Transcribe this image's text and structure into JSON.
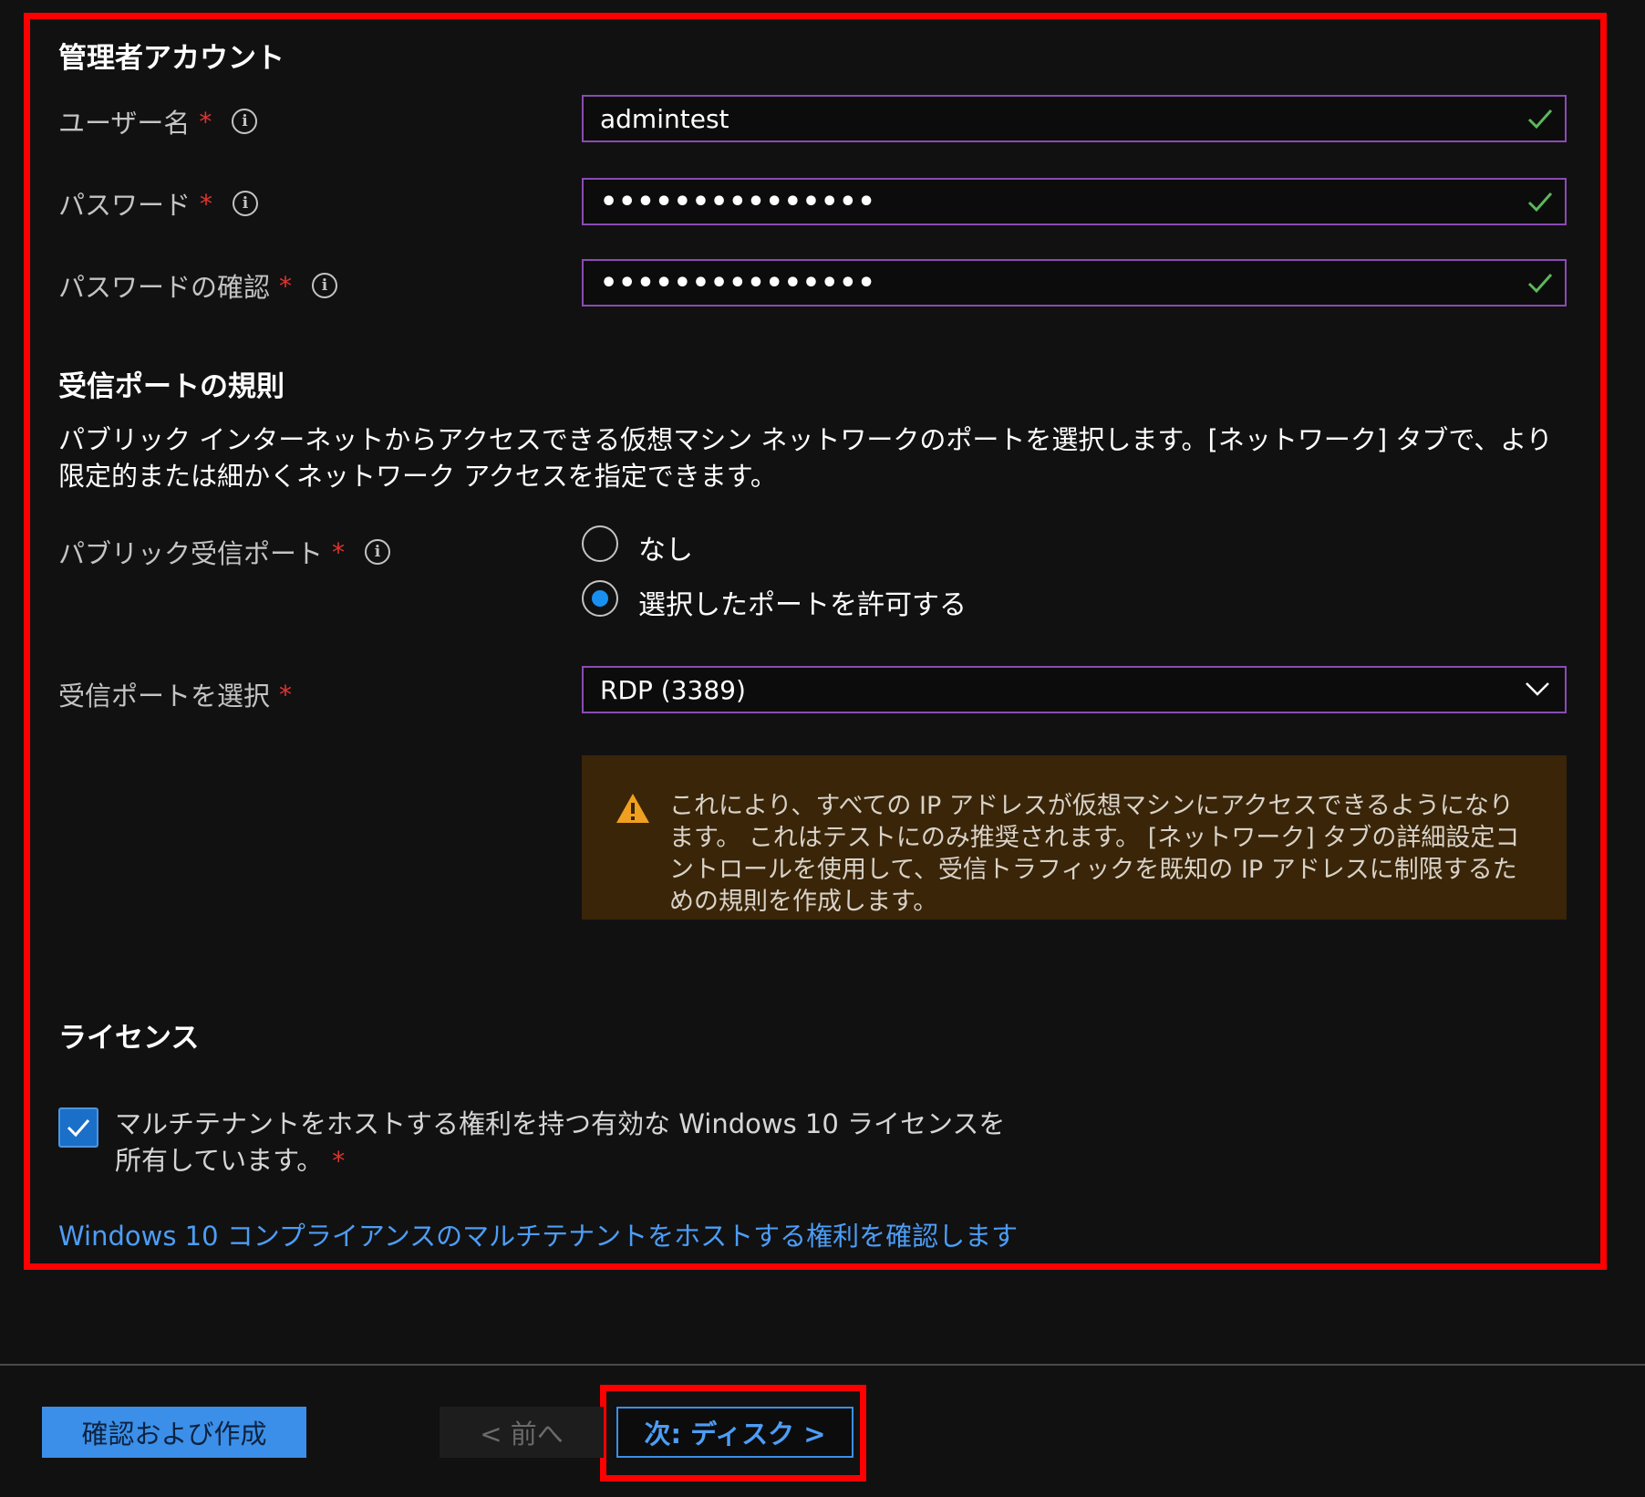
{
  "admin": {
    "section_title": "管理者アカウント",
    "username_label": "ユーザー名",
    "username_value": "admintest",
    "password_label": "パスワード",
    "password_value": "•••••••••••••••",
    "confirm_label": "パスワードの確認",
    "confirm_value": "•••••••••••••••",
    "required_mark": "*",
    "info_glyph": "i"
  },
  "inbound": {
    "section_title": "受信ポートの規則",
    "description": "パブリック インターネットからアクセスできる仮想マシン ネットワークのポートを選択します。[ネットワーク] タブで、より限定的または細かくネットワーク アクセスを指定できます。",
    "public_port_label": "パブリック受信ポート",
    "option_none": "なし",
    "option_allow": "選択したポートを許可する",
    "selected_option": "選択したポートを許可する",
    "select_ports_label": "受信ポートを選択",
    "select_ports_value": "RDP (3389)",
    "warning": "これにより、すべての IP アドレスが仮想マシンにアクセスできるようになります。 これはテストにのみ推奨されます。 [ネットワーク] タブの詳細設定コントロールを使用して、受信トラフィックを既知の IP アドレスに制限するための規則を作成します。"
  },
  "license": {
    "section_title": "ライセンス",
    "checkbox_label": "マルチテナントをホストする権利を持つ有効な Windows 10 ライセンスを所有しています。",
    "checked": true,
    "link": "Windows 10 コンプライアンスのマルチテナントをホストする権利を確認します"
  },
  "footer": {
    "review_create": "確認および作成",
    "prev": "< 前へ",
    "next": "次: ディスク >"
  },
  "colors": {
    "highlight": "#ff0000",
    "accent": "#3b8fe8",
    "input_border": "#8a4bb3",
    "valid_check": "#5cb85c",
    "required": "#e0342f",
    "warning_bg": "#3a2508"
  }
}
